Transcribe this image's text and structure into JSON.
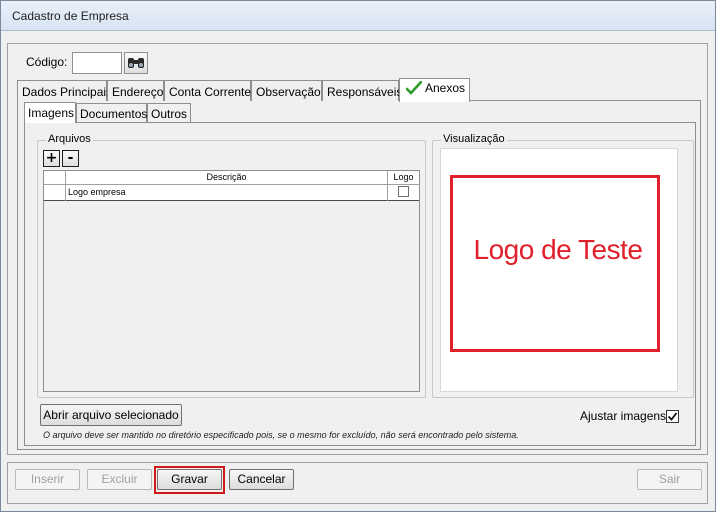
{
  "window": {
    "title": "Cadastro de Empresa"
  },
  "header": {
    "codigo_label": "Código:",
    "codigo_value": ""
  },
  "tabs": [
    {
      "label": "Dados Principais",
      "active": false
    },
    {
      "label": "Endereço",
      "active": false
    },
    {
      "label": "Conta Corrente",
      "active": false
    },
    {
      "label": "Observação",
      "active": false
    },
    {
      "label": "Responsáveis",
      "active": false
    },
    {
      "label": "Anexos",
      "active": true,
      "icon": "checkmark-icon"
    }
  ],
  "subtabs": [
    {
      "label": "Imagens",
      "active": true
    },
    {
      "label": "Documentos",
      "active": false
    },
    {
      "label": "Outros",
      "active": false
    }
  ],
  "arquivos": {
    "group_label": "Arquivos",
    "add_label": "+",
    "remove_label": "-",
    "columns": [
      "Descrição",
      "Logo"
    ],
    "rows": [
      {
        "descricao": "Logo empresa",
        "logo": false
      }
    ]
  },
  "visualizacao": {
    "group_label": "Visualização",
    "preview_text": "Logo de Teste",
    "accent": "#e0202a"
  },
  "actions": {
    "open_file": "Abrir arquivo selecionado",
    "ajustar_label": "Ajustar imagens",
    "ajustar_checked": true,
    "note": "O arquivo deve ser mantido no diretório especificado pois, se o mesmo for excluído, não será encontrado pelo sistema."
  },
  "footer": {
    "inserir": "Inserir",
    "excluir": "Excluir",
    "gravar": "Gravar",
    "cancelar": "Cancelar",
    "sair": "Sair"
  }
}
